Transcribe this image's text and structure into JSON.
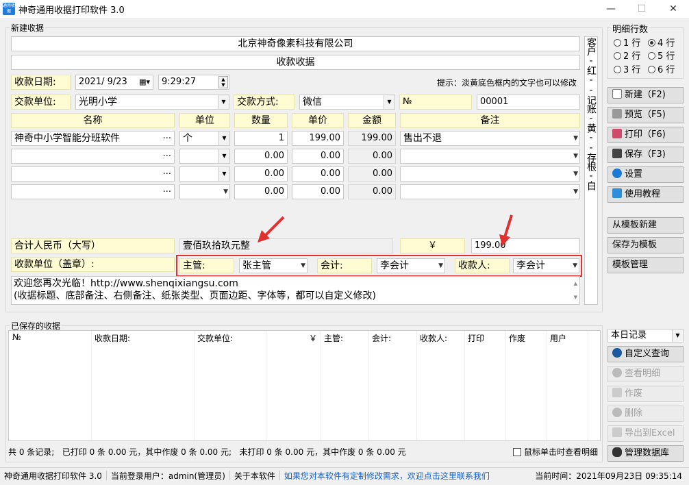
{
  "window": {
    "icon_text": "通用收据",
    "title": "神奇通用收据打印软件 3.0",
    "min": "—",
    "max": "☐",
    "close": "✕"
  },
  "new_receipt": {
    "group_label": "新建收据",
    "company": "北京神奇像素科技有限公司",
    "receipt_title": "收款收据",
    "date_label": "收款日期:",
    "date_value": "2021/ 9/23",
    "time_value": "9:29:27",
    "hint": "提示：淡黄底色框内的文字也可以修改",
    "payer_label": "交款单位:",
    "payer_value": "光明小学",
    "method_label": "交款方式:",
    "method_value": "微信",
    "no_label": "№",
    "no_value": "00001",
    "columns": [
      "名称",
      "单位",
      "数量",
      "单价",
      "金额",
      "备注"
    ],
    "rows": [
      {
        "name": "神奇中小学智能分班软件",
        "unit": "个",
        "qty": "1",
        "price": "199.00",
        "amount": "199.00",
        "note": "售出不退"
      },
      {
        "name": "",
        "unit": "",
        "qty": "0.00",
        "price": "0.00",
        "amount": "0.00",
        "note": ""
      },
      {
        "name": "",
        "unit": "",
        "qty": "0.00",
        "price": "0.00",
        "amount": "0.00",
        "note": ""
      },
      {
        "name": "",
        "unit": "",
        "qty": "0.00",
        "price": "0.00",
        "amount": "0.00",
        "note": ""
      }
    ],
    "dots": "...",
    "total_label": "合计人民币（大写）",
    "total_upper": "壹佰玖拾玖元整",
    "yen": "￥",
    "total_amount": "199.00",
    "stamp_label": "收款单位（盖章）:",
    "supervisor_label": "主管:",
    "supervisor_value": "张主管",
    "accountant_label": "会计:",
    "accountant_value": "李会计",
    "cashier_label": "收款人:",
    "cashier_value": "李会计",
    "footer_line1": "欢迎您再次光临！http://www.shenqixiangsu.com",
    "footer_line2": "(收据标题、底部备注、右侧备注、纸张类型、页面边距、字体等，都可以自定义修改)",
    "side_note": "客户-红--记账-黄--存根-白"
  },
  "rows_panel": {
    "label": "明细行数",
    "options": [
      "1 行",
      "4 行",
      "2 行",
      "5 行",
      "3 行",
      "6 行"
    ],
    "selected": "4 行"
  },
  "buttons": {
    "new": "新建（F2)",
    "preview": "预览（F5)",
    "print": "打印（F6)",
    "save": "保存（F3)",
    "settings": "设置",
    "tutorial": "使用教程",
    "from_template": "从模板新建",
    "save_template": "保存为模板",
    "manage_template": "模板管理",
    "custom_query": "自定义查询",
    "view_detail": "查看明细",
    "void": "作废",
    "delete": "删除",
    "export": "导出到Excel",
    "manage_db": "管理数据库"
  },
  "saved": {
    "group_label": "已保存的收据",
    "columns": [
      "№",
      "收款日期:",
      "交款单位:",
      "￥",
      "主管:",
      "会计:",
      "收款人:",
      "打印",
      "作废",
      "用户"
    ],
    "filter": "本日记录",
    "summary": "共 0 条记录;   已打印 0 条 0.00 元，其中作废 0 条 0.00 元;   未打印 0 条 0.00 元，其中作废 0 条 0.00 元",
    "click_check_label": "鼠标单击时查看明细"
  },
  "status": {
    "app": "神奇通用收据打印软件 3.0",
    "user": "当前登录用户：admin(管理员)",
    "about": "关于本软件",
    "link": "如果您对本软件有定制修改需求，欢迎点击这里联系我们",
    "time": "当前时间：2021年09月23日 09:35:14"
  },
  "colors": {
    "highlight": "#fffbd2",
    "red_box": "#e03030",
    "link": "#1060d0"
  }
}
